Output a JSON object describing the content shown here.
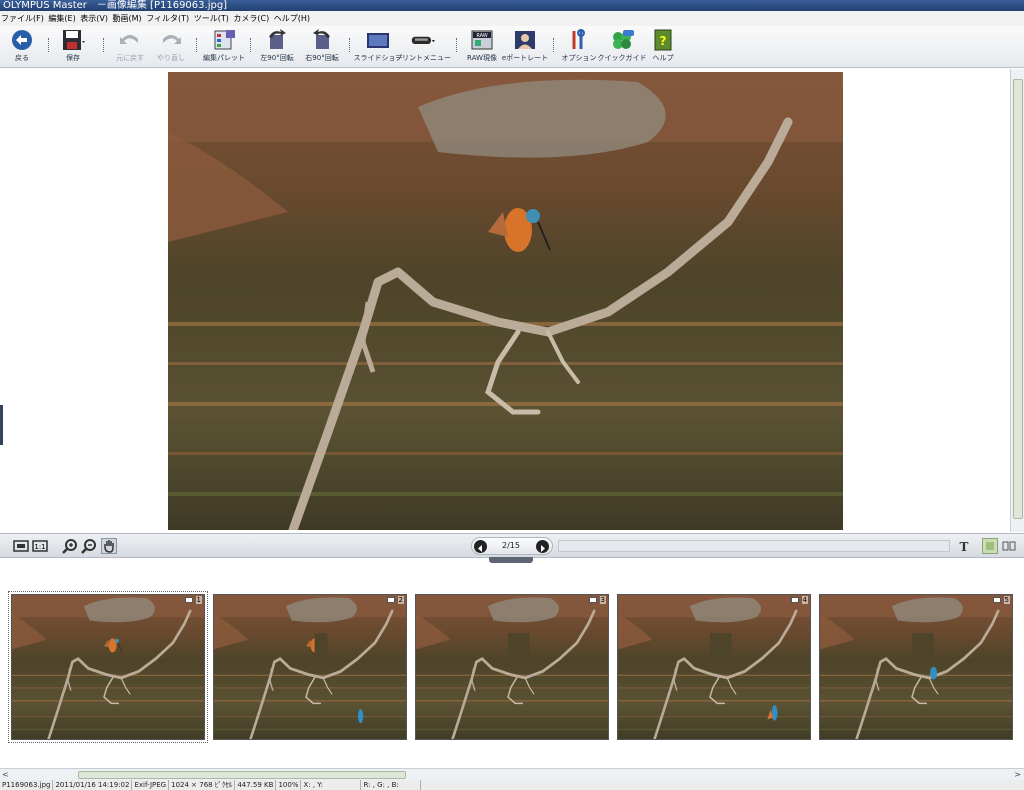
{
  "window": {
    "title": "OLYMPUS Master　－画像編集 [P1169063.jpg]"
  },
  "menu": [
    "ファイル(F)",
    "編集(E)",
    "表示(V)",
    "動画(M)",
    "フィルタ(T)",
    "ツール(T)",
    "カメラ(C)",
    "ヘルプ(H)"
  ],
  "toolbar": {
    "back": "戻る",
    "save": "保存",
    "undo": "元に戻す",
    "redo": "やり直し",
    "palette": "編集パレット",
    "rot_left": "左90°回転",
    "rot_right": "右90°回転",
    "slideshow": "スライドショー",
    "print": "プリントメニュー",
    "raw": "RAW現像",
    "eport": "eポートレート",
    "options": "オプション",
    "quickguide": "クイックガイド",
    "help": "ヘルプ"
  },
  "toolbar_colors": {
    "accent": "#2a5fa8",
    "disabled": "#9aa1aa"
  },
  "navigator": {
    "page": "2/15"
  },
  "thumbnails": [
    {
      "number": "1",
      "kingfisher": "orange",
      "selected": true
    },
    {
      "number": "2",
      "kingfisher": "blue",
      "selected": false
    },
    {
      "number": "3",
      "kingfisher": "none",
      "selected": false
    },
    {
      "number": "4",
      "kingfisher": "blue",
      "selected": false
    },
    {
      "number": "5",
      "kingfisher": "blue",
      "selected": false
    }
  ],
  "status": {
    "filename": "P1169063.jpg",
    "datetime": "2011/01/16 14:19:02",
    "format": "Exif-JPEG",
    "dimensions": "1024 × 768 ﾋﾟｸｾﾙ",
    "size": "447.59 KB",
    "zoom": "100%",
    "xy": "X: , Y:",
    "rgb": "R: , G: , B:"
  },
  "icons": {
    "back": "back-arrow-icon",
    "save": "floppy-disk-icon",
    "undo": "undo-icon",
    "redo": "redo-icon",
    "help": "help-book-icon"
  }
}
